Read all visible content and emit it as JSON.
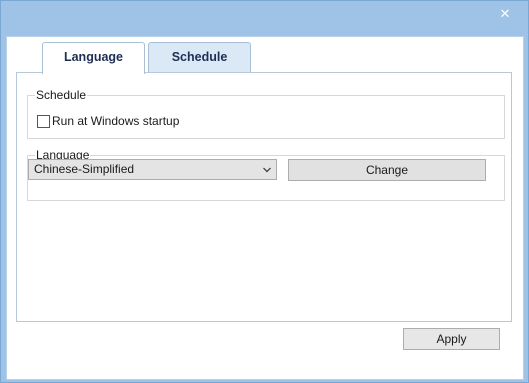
{
  "window": {
    "close_glyph": "✕",
    "close_icon": "close-icon"
  },
  "tabs": [
    {
      "label": "Language"
    },
    {
      "label": "Schedule"
    }
  ],
  "schedule_group": {
    "title": "Schedule",
    "run_at_startup_label": "Run at Windows startup",
    "run_at_startup_checked": false
  },
  "language_group": {
    "title": "Language",
    "selected_language": "Chinese-Simplified",
    "dropdown_icon": "chevron-down-icon",
    "change_label": "Change"
  },
  "footer": {
    "apply_label": "Apply"
  },
  "colors": {
    "title_bar": "#9ec3e6",
    "tab_text": "#1e2f55",
    "active_tab_bg": "#ffffff",
    "inactive_tab_bg": "#dbe9f6"
  }
}
